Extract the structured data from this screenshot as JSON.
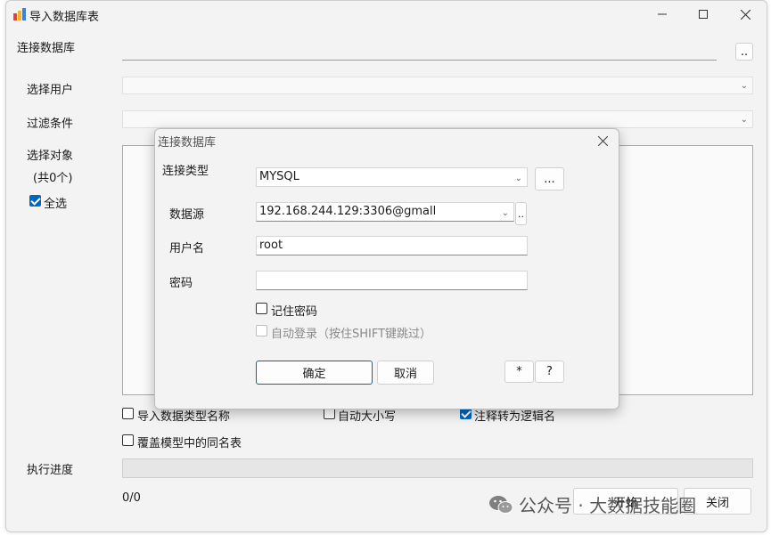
{
  "window": {
    "title": "导入数据库表"
  },
  "form": {
    "connect_db_label": "连接数据库",
    "browse_button": "..",
    "select_user_label": "选择用户",
    "filter_label": "过滤条件",
    "select_object_label": "选择对象",
    "count_text": "(共0个)",
    "select_all_label": "全选",
    "import_type_name_label": "导入数据类型名称",
    "auto_case_label": "自动大小写",
    "comment_to_logical_label": "注释转为逻辑名",
    "overwrite_same_name_label": "覆盖模型中的同名表",
    "progress_label": "执行进度",
    "progress_text": "0/0",
    "start_button": "开始",
    "close_button": "关闭"
  },
  "checks": {
    "select_all": true,
    "import_type_name": false,
    "auto_case": false,
    "comment_to_logical": true,
    "overwrite_same_name": false
  },
  "dialog": {
    "title": "连接数据库",
    "conn_type_label": "连接类型",
    "conn_type_value": "MYSQL",
    "conn_type_more": "...",
    "datasource_label": "数据源",
    "datasource_value": "192.168.244.129:3306@gmall",
    "datasource_more": "..",
    "username_label": "用户名",
    "username_value": "root",
    "password_label": "密码",
    "password_value": "",
    "remember_label": "记住密码",
    "autologin_label": "自动登录（按住SHIFT键跳过）",
    "ok_button": "确定",
    "cancel_button": "取消",
    "star_button": "*",
    "help_button": "?",
    "remember": false,
    "autologin": false
  },
  "watermark": {
    "text": "公众号 · 大数据技能圈"
  },
  "colors": {
    "accent": "#0067c0"
  }
}
